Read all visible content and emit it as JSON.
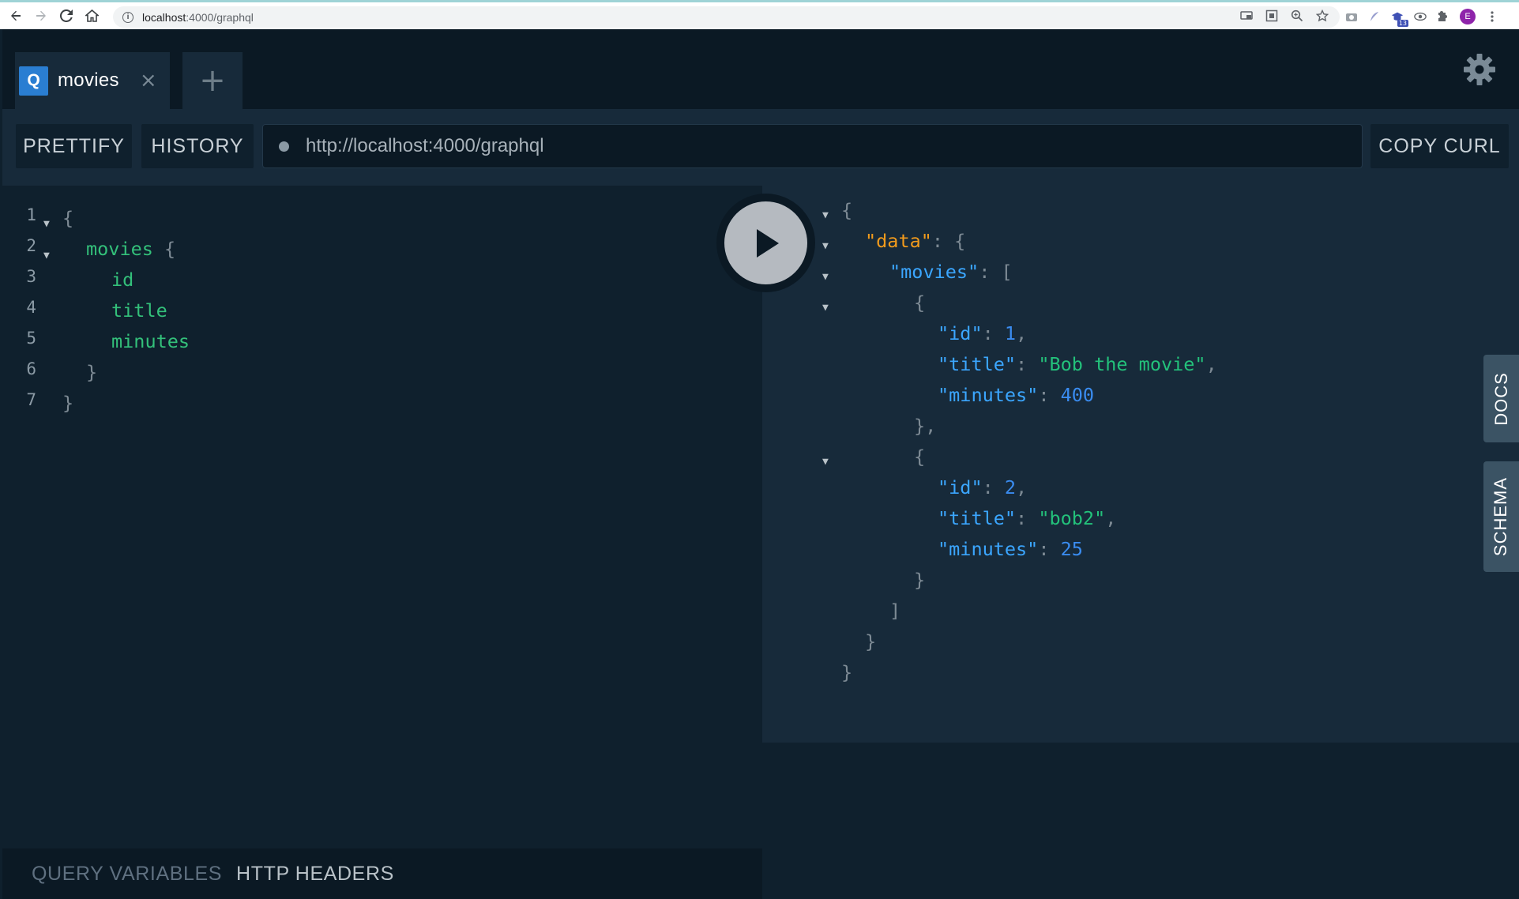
{
  "browser": {
    "url_host": "localhost",
    "url_rest": ":4000/graphql",
    "avatar_letter": "E",
    "extension_badge": "13"
  },
  "tabs": [
    {
      "badge": "Q",
      "label": "movies",
      "close": "×"
    }
  ],
  "tab_add_symbol": "+",
  "toolbar": {
    "prettify_label": "PRETTIFY",
    "history_label": "HISTORY",
    "endpoint": "http://localhost:4000/graphql",
    "copy_curl_label": "COPY CURL"
  },
  "editor": {
    "line_numbers": [
      "1",
      "2",
      "3",
      "4",
      "5",
      "6",
      "7"
    ],
    "lines": {
      "l1": "{",
      "l2_field": "movies",
      "l2_brace": " {",
      "l3": "id",
      "l4": "title",
      "l5": "minutes",
      "l6": "}",
      "l7": "}"
    }
  },
  "bottom": {
    "query_variables_label": "QUERY VARIABLES",
    "http_headers_label": "HTTP HEADERS"
  },
  "result": {
    "data_key": "\"data\"",
    "movies_key": "\"movies\"",
    "items": [
      {
        "id_key": "\"id\"",
        "id": "1",
        "title_key": "\"title\"",
        "title": "\"Bob the movie\"",
        "minutes_key": "\"minutes\"",
        "minutes": "400"
      },
      {
        "id_key": "\"id\"",
        "id": "2",
        "title_key": "\"title\"",
        "title": "\"bob2\"",
        "minutes_key": "\"minutes\"",
        "minutes": "25"
      }
    ]
  },
  "side_tabs": {
    "docs_label": "DOCS",
    "schema_label": "SCHEMA"
  },
  "colors": {
    "background": "#0f202d",
    "panel": "#172a3a",
    "accent": "#2a7ed2",
    "field_green": "#33c07a",
    "key_blue": "#3ba6ff",
    "key_orange": "#f29b1c",
    "number_blue": "#3a8cf0"
  },
  "icons": [
    "back-arrow-icon",
    "forward-arrow-icon",
    "reload-icon",
    "home-icon",
    "info-icon",
    "cast-icon",
    "qr-icon",
    "zoom-icon",
    "star-icon",
    "puzzle-icon",
    "gear-icon",
    "play-icon",
    "fold-arrow-icon"
  ]
}
